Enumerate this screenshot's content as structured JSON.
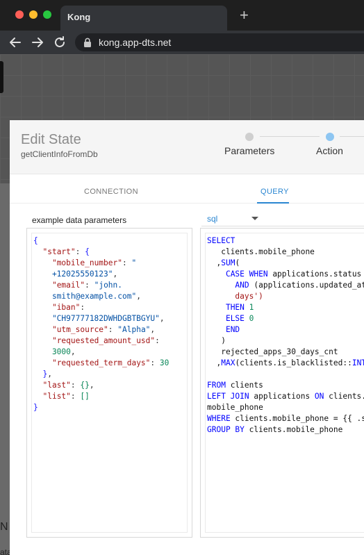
{
  "browser": {
    "tab_title": "Kong",
    "new_tab": "+",
    "url": "kong.app-dts.net"
  },
  "background": {
    "text1": "N",
    "text2": "ata"
  },
  "modal": {
    "title": "Edit State",
    "subtitle": "getClientInfoFromDb",
    "steps": [
      "Parameters",
      "Action"
    ],
    "tabs": {
      "connection": "CONNECTION",
      "query": "QUERY"
    },
    "param_label": "example data parameters",
    "language": "sql"
  },
  "json_lines": [
    [
      {
        "c": "b",
        "t": "{"
      }
    ],
    [
      {
        "c": "p",
        "t": "  "
      },
      {
        "c": "k",
        "t": "\"start\""
      },
      {
        "c": "p",
        "t": ": "
      },
      {
        "c": "b",
        "t": "{"
      }
    ],
    [
      {
        "c": "p",
        "t": "    "
      },
      {
        "c": "k",
        "t": "\"mobile_number\""
      },
      {
        "c": "p",
        "t": ": "
      },
      {
        "c": "s",
        "t": "\""
      }
    ],
    [
      {
        "c": "s",
        "t": "    +12025550123\""
      },
      {
        "c": "p",
        "t": ","
      }
    ],
    [
      {
        "c": "p",
        "t": "    "
      },
      {
        "c": "k",
        "t": "\"email\""
      },
      {
        "c": "p",
        "t": ": "
      },
      {
        "c": "s",
        "t": "\"john."
      }
    ],
    [
      {
        "c": "s",
        "t": "    smith@example.com\""
      },
      {
        "c": "p",
        "t": ","
      }
    ],
    [
      {
        "c": "p",
        "t": "    "
      },
      {
        "c": "k",
        "t": "\"iban\""
      },
      {
        "c": "p",
        "t": ":"
      }
    ],
    [
      {
        "c": "s",
        "t": "    \"CH97777182DWHDGBTBGYU\""
      },
      {
        "c": "p",
        "t": ","
      }
    ],
    [
      {
        "c": "p",
        "t": "    "
      },
      {
        "c": "k",
        "t": "\"utm_source\""
      },
      {
        "c": "p",
        "t": ": "
      },
      {
        "c": "s",
        "t": "\"Alpha\""
      },
      {
        "c": "p",
        "t": ","
      }
    ],
    [
      {
        "c": "p",
        "t": "    "
      },
      {
        "c": "k",
        "t": "\"requested_amount_usd\""
      },
      {
        "c": "p",
        "t": ":"
      }
    ],
    [
      {
        "c": "n",
        "t": "    3000"
      },
      {
        "c": "p",
        "t": ","
      }
    ],
    [
      {
        "c": "p",
        "t": "    "
      },
      {
        "c": "k",
        "t": "\"requested_term_days\""
      },
      {
        "c": "p",
        "t": ": "
      },
      {
        "c": "n",
        "t": "30"
      }
    ],
    [
      {
        "c": "p",
        "t": "  "
      },
      {
        "c": "b",
        "t": "}"
      },
      {
        "c": "p",
        "t": ","
      }
    ],
    [
      {
        "c": "p",
        "t": "  "
      },
      {
        "c": "k",
        "t": "\"last\""
      },
      {
        "c": "p",
        "t": ": "
      },
      {
        "c": "n",
        "t": "{}"
      },
      {
        "c": "p",
        "t": ","
      }
    ],
    [
      {
        "c": "p",
        "t": "  "
      },
      {
        "c": "k",
        "t": "\"list\""
      },
      {
        "c": "p",
        "t": ": "
      },
      {
        "c": "n",
        "t": "[]"
      }
    ],
    [
      {
        "c": "b",
        "t": "}"
      }
    ]
  ],
  "sql_lines": [
    [
      {
        "c": "kw",
        "t": "SELECT"
      }
    ],
    [
      {
        "c": "tx",
        "t": "   clients.mobile_phone"
      }
    ],
    [
      {
        "c": "tx",
        "t": "  ,"
      },
      {
        "c": "kw",
        "t": "SUM"
      },
      {
        "c": "tx",
        "t": "("
      }
    ],
    [
      {
        "c": "tx",
        "t": "    "
      },
      {
        "c": "kw",
        "t": "CASE WHEN"
      },
      {
        "c": "tx",
        "t": " applications.status ="
      }
    ],
    [
      {
        "c": "tx",
        "t": "      "
      },
      {
        "c": "kw",
        "t": "AND"
      },
      {
        "c": "tx",
        "t": " (applications.updated_at"
      }
    ],
    [
      {
        "c": "str",
        "t": "      days')"
      }
    ],
    [
      {
        "c": "tx",
        "t": "    "
      },
      {
        "c": "kw",
        "t": "THEN"
      },
      {
        "c": "tx",
        "t": " "
      },
      {
        "c": "num",
        "t": "1"
      }
    ],
    [
      {
        "c": "tx",
        "t": "    "
      },
      {
        "c": "kw",
        "t": "ELSE"
      },
      {
        "c": "tx",
        "t": " "
      },
      {
        "c": "num",
        "t": "0"
      }
    ],
    [
      {
        "c": "tx",
        "t": "    "
      },
      {
        "c": "kw",
        "t": "END"
      }
    ],
    [
      {
        "c": "tx",
        "t": "   )"
      }
    ],
    [
      {
        "c": "tx",
        "t": "   rejected_apps_30_days_cnt"
      }
    ],
    [
      {
        "c": "tx",
        "t": "  ,"
      },
      {
        "c": "kw",
        "t": "MAX"
      },
      {
        "c": "tx",
        "t": "(clients.is_blacklisted::"
      },
      {
        "c": "kw",
        "t": "INT"
      }
    ],
    [
      {
        "c": "tx",
        "t": ""
      }
    ],
    [
      {
        "c": "kw",
        "t": "FROM"
      },
      {
        "c": "tx",
        "t": " clients"
      }
    ],
    [
      {
        "c": "kw",
        "t": "LEFT JOIN"
      },
      {
        "c": "tx",
        "t": " applications "
      },
      {
        "c": "kw",
        "t": "ON"
      },
      {
        "c": "tx",
        "t": " clients.m"
      }
    ],
    [
      {
        "c": "tx",
        "t": "mobile_phone"
      }
    ],
    [
      {
        "c": "kw",
        "t": "WHERE"
      },
      {
        "c": "tx",
        "t": " clients.mobile_phone = {{ .st"
      }
    ],
    [
      {
        "c": "kw",
        "t": "GROUP BY"
      },
      {
        "c": "tx",
        "t": " clients.mobile_phone"
      }
    ]
  ]
}
